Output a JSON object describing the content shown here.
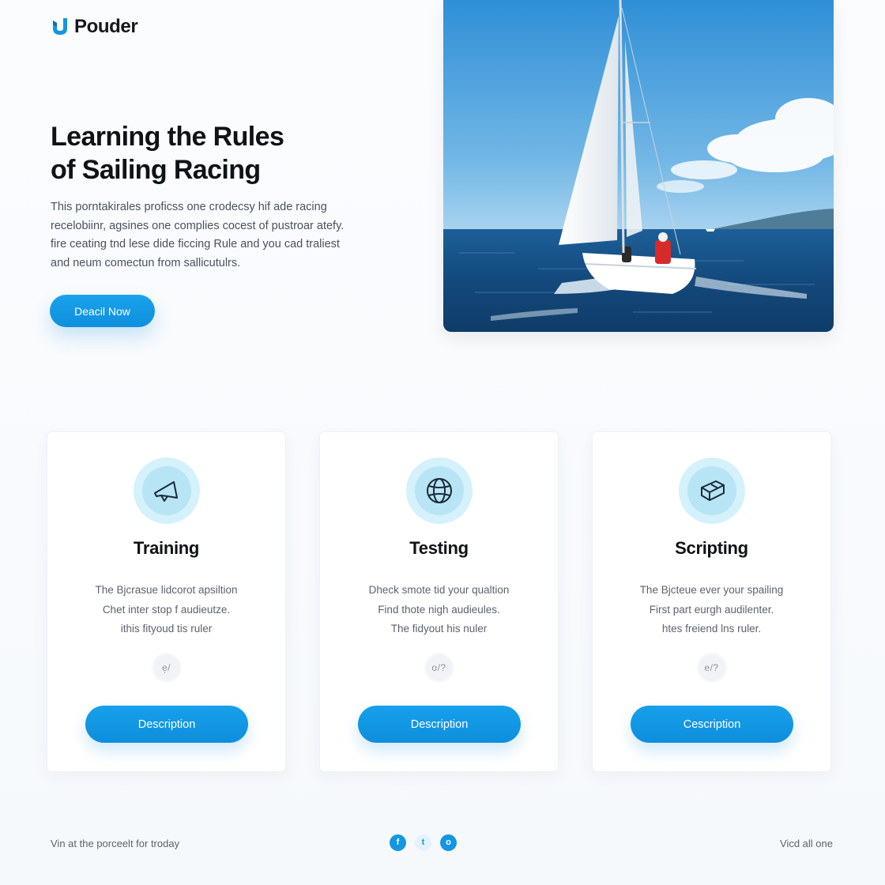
{
  "brand": {
    "name": "Pouder",
    "logo_icon": "pouder-logo-icon",
    "accent": "#1496e2"
  },
  "hero": {
    "title_lines": [
      "Learning the Rules",
      "of Sailing Racing"
    ],
    "description_lines": [
      "This porntakirales proficss one crodecsy hif ade racing",
      "recelobiinr, agsines one complies cocest of pustroar atefy.",
      "fire ceating tnd lese dide ficcing Rule and you cad traliest",
      "and neum comectun from sallicutulrs."
    ],
    "cta_label": "Deacil Now",
    "image_alt": "Sailboat racing on open sea"
  },
  "cards": [
    {
      "icon": "megaphone-icon",
      "title": "Training",
      "text_lines": [
        "The Bjcrasue lidcorot apsiltion",
        "Chet inter stop f audieutze.",
        "ithis fityoud tis ruler"
      ],
      "badge": "e̩/",
      "button_label": "Description"
    },
    {
      "icon": "globe-icon",
      "title": "Testing",
      "text_lines": [
        "Dheck smote tid your qualtion",
        "Find thote nigh audieules.",
        "The fidyout his nuler"
      ],
      "badge": "o/?",
      "button_label": "Description"
    },
    {
      "icon": "box-icon",
      "title": "Scripting",
      "text_lines": [
        "The Bjcteue ever your spailing",
        "First part eurgh audilenter.",
        "htes freiend lns ruler."
      ],
      "badge": "e/?",
      "button_label": "Cescription"
    }
  ],
  "footer": {
    "left_text": "Vin at the porceelt for troday",
    "right_text": "Vicd all one",
    "social": [
      {
        "icon": "facebook-icon",
        "glyph": "f",
        "style": "solid"
      },
      {
        "icon": "twitter-icon",
        "glyph": "t",
        "style": "light"
      },
      {
        "icon": "instagram-icon",
        "glyph": "o",
        "style": "solid"
      }
    ]
  }
}
